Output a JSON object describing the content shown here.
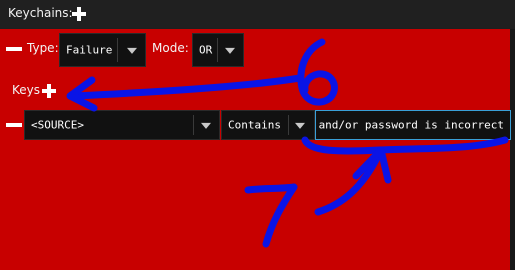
{
  "header": {
    "title": "Keychains:",
    "add_icon": "plus-icon"
  },
  "keychain": {
    "remove_icon": "minus-icon",
    "type_label": "Type:",
    "type_value": "Failure",
    "mode_label": "Mode:",
    "mode_value": "OR"
  },
  "keys": {
    "label": "Keys",
    "add_icon": "plus-icon",
    "row": {
      "remove_icon": "minus-icon",
      "source_value": "<SOURCE>",
      "operator_value": "Contains",
      "text_value": "and/or password is incorrect"
    }
  },
  "annotations": {
    "number_6": "6",
    "number_7": "7",
    "ink_color": "#0a14e6"
  },
  "colors": {
    "panel_background": "#c80000",
    "header_background": "#202020",
    "field_background": "#111111",
    "focus_border": "#3aa0d8"
  }
}
